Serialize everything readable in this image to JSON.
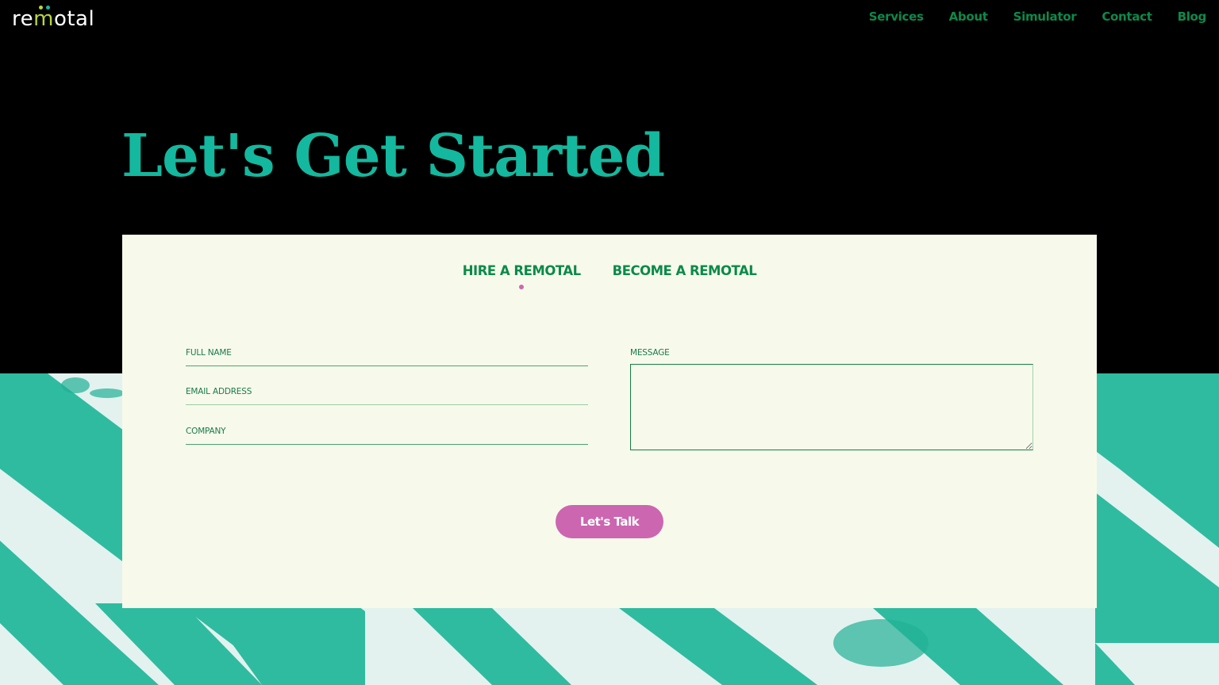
{
  "header": {
    "logo": {
      "prefix": "re",
      "m": "m",
      "suffix": "otal",
      "dot_colors": [
        "#b6d83a",
        "#13b89e"
      ]
    },
    "nav": [
      {
        "label": "Services"
      },
      {
        "label": "About"
      },
      {
        "label": "Simulator"
      },
      {
        "label": "Contact"
      },
      {
        "label": "Blog"
      }
    ]
  },
  "hero": {
    "title": "Let's Get Started"
  },
  "form": {
    "tabs": [
      {
        "label": "HIRE A REMOTAL",
        "active": true
      },
      {
        "label": "BECOME A REMOTAL",
        "active": false
      }
    ],
    "fields": {
      "full_name": {
        "label": "FULL NAME",
        "value": ""
      },
      "email": {
        "label": "EMAIL ADDRESS",
        "value": ""
      },
      "company": {
        "label": "COMPANY",
        "value": ""
      },
      "message": {
        "label": "MESSAGE",
        "value": ""
      }
    },
    "submit_label": "Let's Talk"
  },
  "colors": {
    "accent_green": "#0b8a4a",
    "title_teal": "#13b89e",
    "card_bg": "#f7faea",
    "button_pink": "#cc66b0",
    "stripe_teal": "#2fbba0",
    "stripe_light": "#e3f2ef"
  }
}
